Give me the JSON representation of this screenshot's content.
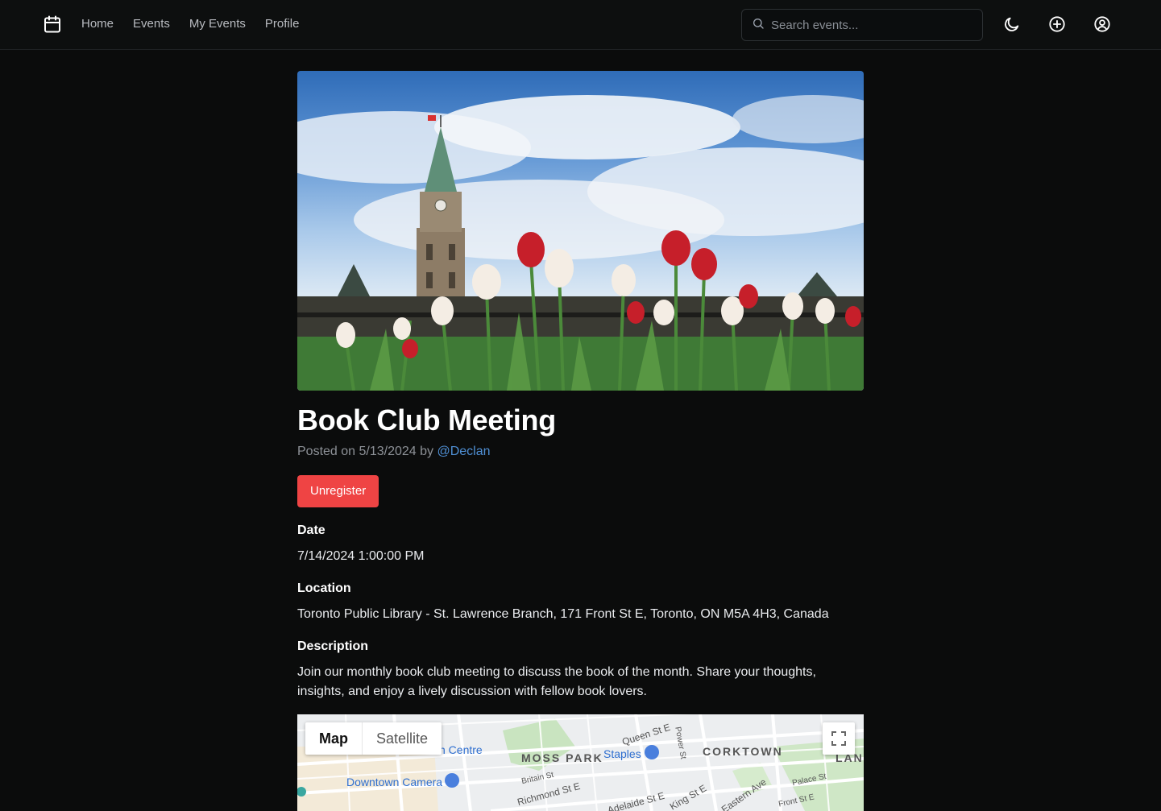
{
  "nav": {
    "links": [
      "Home",
      "Events",
      "My Events",
      "Profile"
    ],
    "search_placeholder": "Search events..."
  },
  "event": {
    "title": "Book Club Meeting",
    "posted_prefix": "Posted on 5/13/2024 by ",
    "author": "@Declan",
    "unregister_label": "Unregister",
    "date_label": "Date",
    "date_value": "7/14/2024 1:00:00 PM",
    "location_label": "Location",
    "location_value": "Toronto Public Library - St. Lawrence Branch, 171 Front St E, Toronto, ON M5A 4H3, Canada",
    "description_label": "Description",
    "description_value": "Join our monthly book club meeting to discuss the book of the month. Share your thoughts, insights, and enjoy a lively discussion with fellow book lovers."
  },
  "map": {
    "toggle_map": "Map",
    "toggle_satellite": "Satellite",
    "labels": {
      "centre": "n Centre",
      "moss_park": "MOSS PARK",
      "corktown": "CORKTOWN",
      "land": "LAND",
      "queen": "Queen St E",
      "power": "Power St",
      "staples": "Staples",
      "downtown_camera": "Downtown Camera",
      "britain": "Britain St",
      "richmond": "Richmond St E",
      "adelaide": "Adelaide St E",
      "king": "King St E",
      "eastern": "Eastern Ave",
      "palace": "Palace St",
      "front": "Front St E"
    }
  },
  "colors": {
    "accent_red": "#ef4444",
    "link_blue": "#4f8fd4",
    "background": "#0b0c0c"
  }
}
